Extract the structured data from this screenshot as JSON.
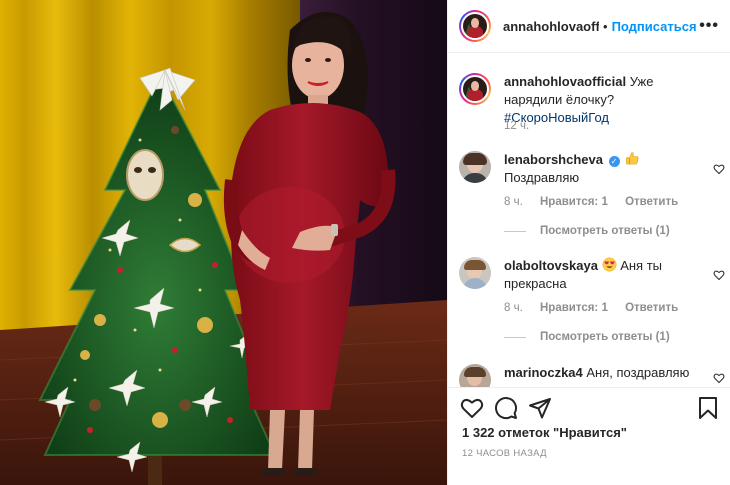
{
  "post": {
    "author": "annahohlovaofficial",
    "author_header": "annahohlovaoffic",
    "separator": "•",
    "follow_label": "Подписаться",
    "more_label": "•••",
    "caption_text": "Уже нарядили ёлочку?",
    "caption_hashtag": "#СкороНовыйГод",
    "caption_time": "12 ч.",
    "likes": "1 322 отметок \"Нравится\"",
    "posted": "12 ЧАСОВ НАЗАД"
  },
  "comments": [
    {
      "user": "lenaborshcheva",
      "verified": true,
      "emoji": "thumbs-up",
      "text": "Поздравляю",
      "time": "8 ч.",
      "likes": "Нравится: 1",
      "reply": "Ответить",
      "view_replies": "Посмотреть ответы (1)"
    },
    {
      "user": "olaboltovskaya",
      "verified": false,
      "emoji": "heart-eyes",
      "text": "Аня ты прекрасна",
      "time": "8 ч.",
      "likes": "Нравится: 1",
      "reply": "Ответить",
      "view_replies": "Посмотреть ответы (1)"
    },
    {
      "user": "marinoczka4",
      "verified": false,
      "text": "Аня, поздравляю от"
    }
  ],
  "icons": [
    "heart-icon",
    "comment-icon",
    "share-icon",
    "bookmark-icon"
  ],
  "colors": {
    "link_blue": "#0095f6",
    "hashtag": "#00376b",
    "muted": "#8e8e8e",
    "text": "#262626"
  }
}
